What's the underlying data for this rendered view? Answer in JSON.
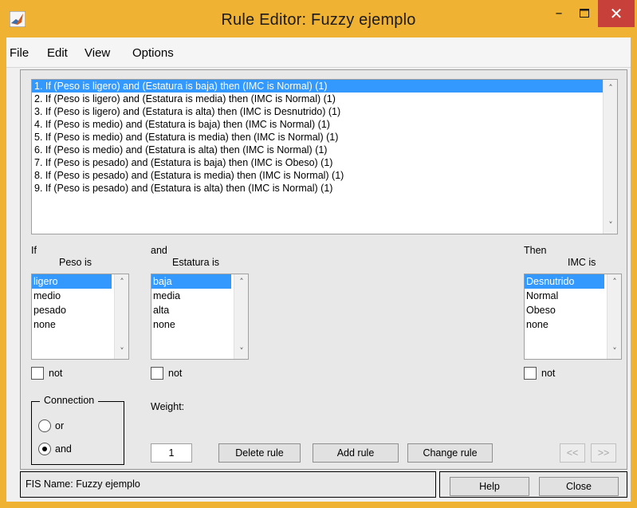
{
  "window": {
    "title": "Rule Editor: Fuzzy ejemplo",
    "minimize_glyph": "–",
    "close_glyph": "✕"
  },
  "menu": {
    "items": [
      "File",
      "Edit",
      "View",
      "Options"
    ]
  },
  "rules": [
    "1. If (Peso is ligero) and (Estatura is baja) then (IMC is Normal) (1)",
    "2. If (Peso is ligero) and (Estatura is media) then (IMC is Normal) (1)",
    "3. If (Peso is ligero) and (Estatura is alta) then (IMC is Desnutrido) (1)",
    "4. If (Peso is medio) and (Estatura is baja) then (IMC is Normal) (1)",
    "5. If (Peso is medio) and (Estatura is media) then (IMC is Normal) (1)",
    "6. If (Peso is medio) and (Estatura is alta) then (IMC is Normal) (1)",
    "7. If (Peso is pesado) and (Estatura is baja) then (IMC is Obeso) (1)",
    "8. If (Peso is pesado) and (Estatura is media) then (IMC is Normal) (1)",
    "9. If (Peso is pesado) and (Estatura is alta) then (IMC is Normal) (1)"
  ],
  "selected_rule_index": 0,
  "peso": {
    "section_label": "If",
    "title": "Peso is",
    "options": [
      "ligero",
      "medio",
      "pesado",
      "none"
    ],
    "selected": "ligero",
    "not_label": "not"
  },
  "estatura": {
    "section_label": "and",
    "title": "Estatura is",
    "options": [
      "baja",
      "media",
      "alta",
      "none"
    ],
    "selected": "baja",
    "not_label": "not"
  },
  "imc": {
    "section_label": "Then",
    "title": "IMC is",
    "options": [
      "Desnutrido",
      "Normal",
      "Obeso",
      "none"
    ],
    "selected": "Desnutrido",
    "not_label": "not"
  },
  "connection": {
    "title": "Connection",
    "or_label": "or",
    "and_label": "and",
    "selected": "and"
  },
  "weight": {
    "label": "Weight:",
    "value": "1"
  },
  "buttons": {
    "delete": "Delete rule",
    "add": "Add rule",
    "change": "Change rule",
    "prev": "<<",
    "next": ">>",
    "help": "Help",
    "close": "Close"
  },
  "status": {
    "fis_name": "FIS Name: Fuzzy ejemplo"
  },
  "colors": {
    "window_border": "#f0b233",
    "selection": "#3399ff",
    "close_button": "#c7403a"
  }
}
